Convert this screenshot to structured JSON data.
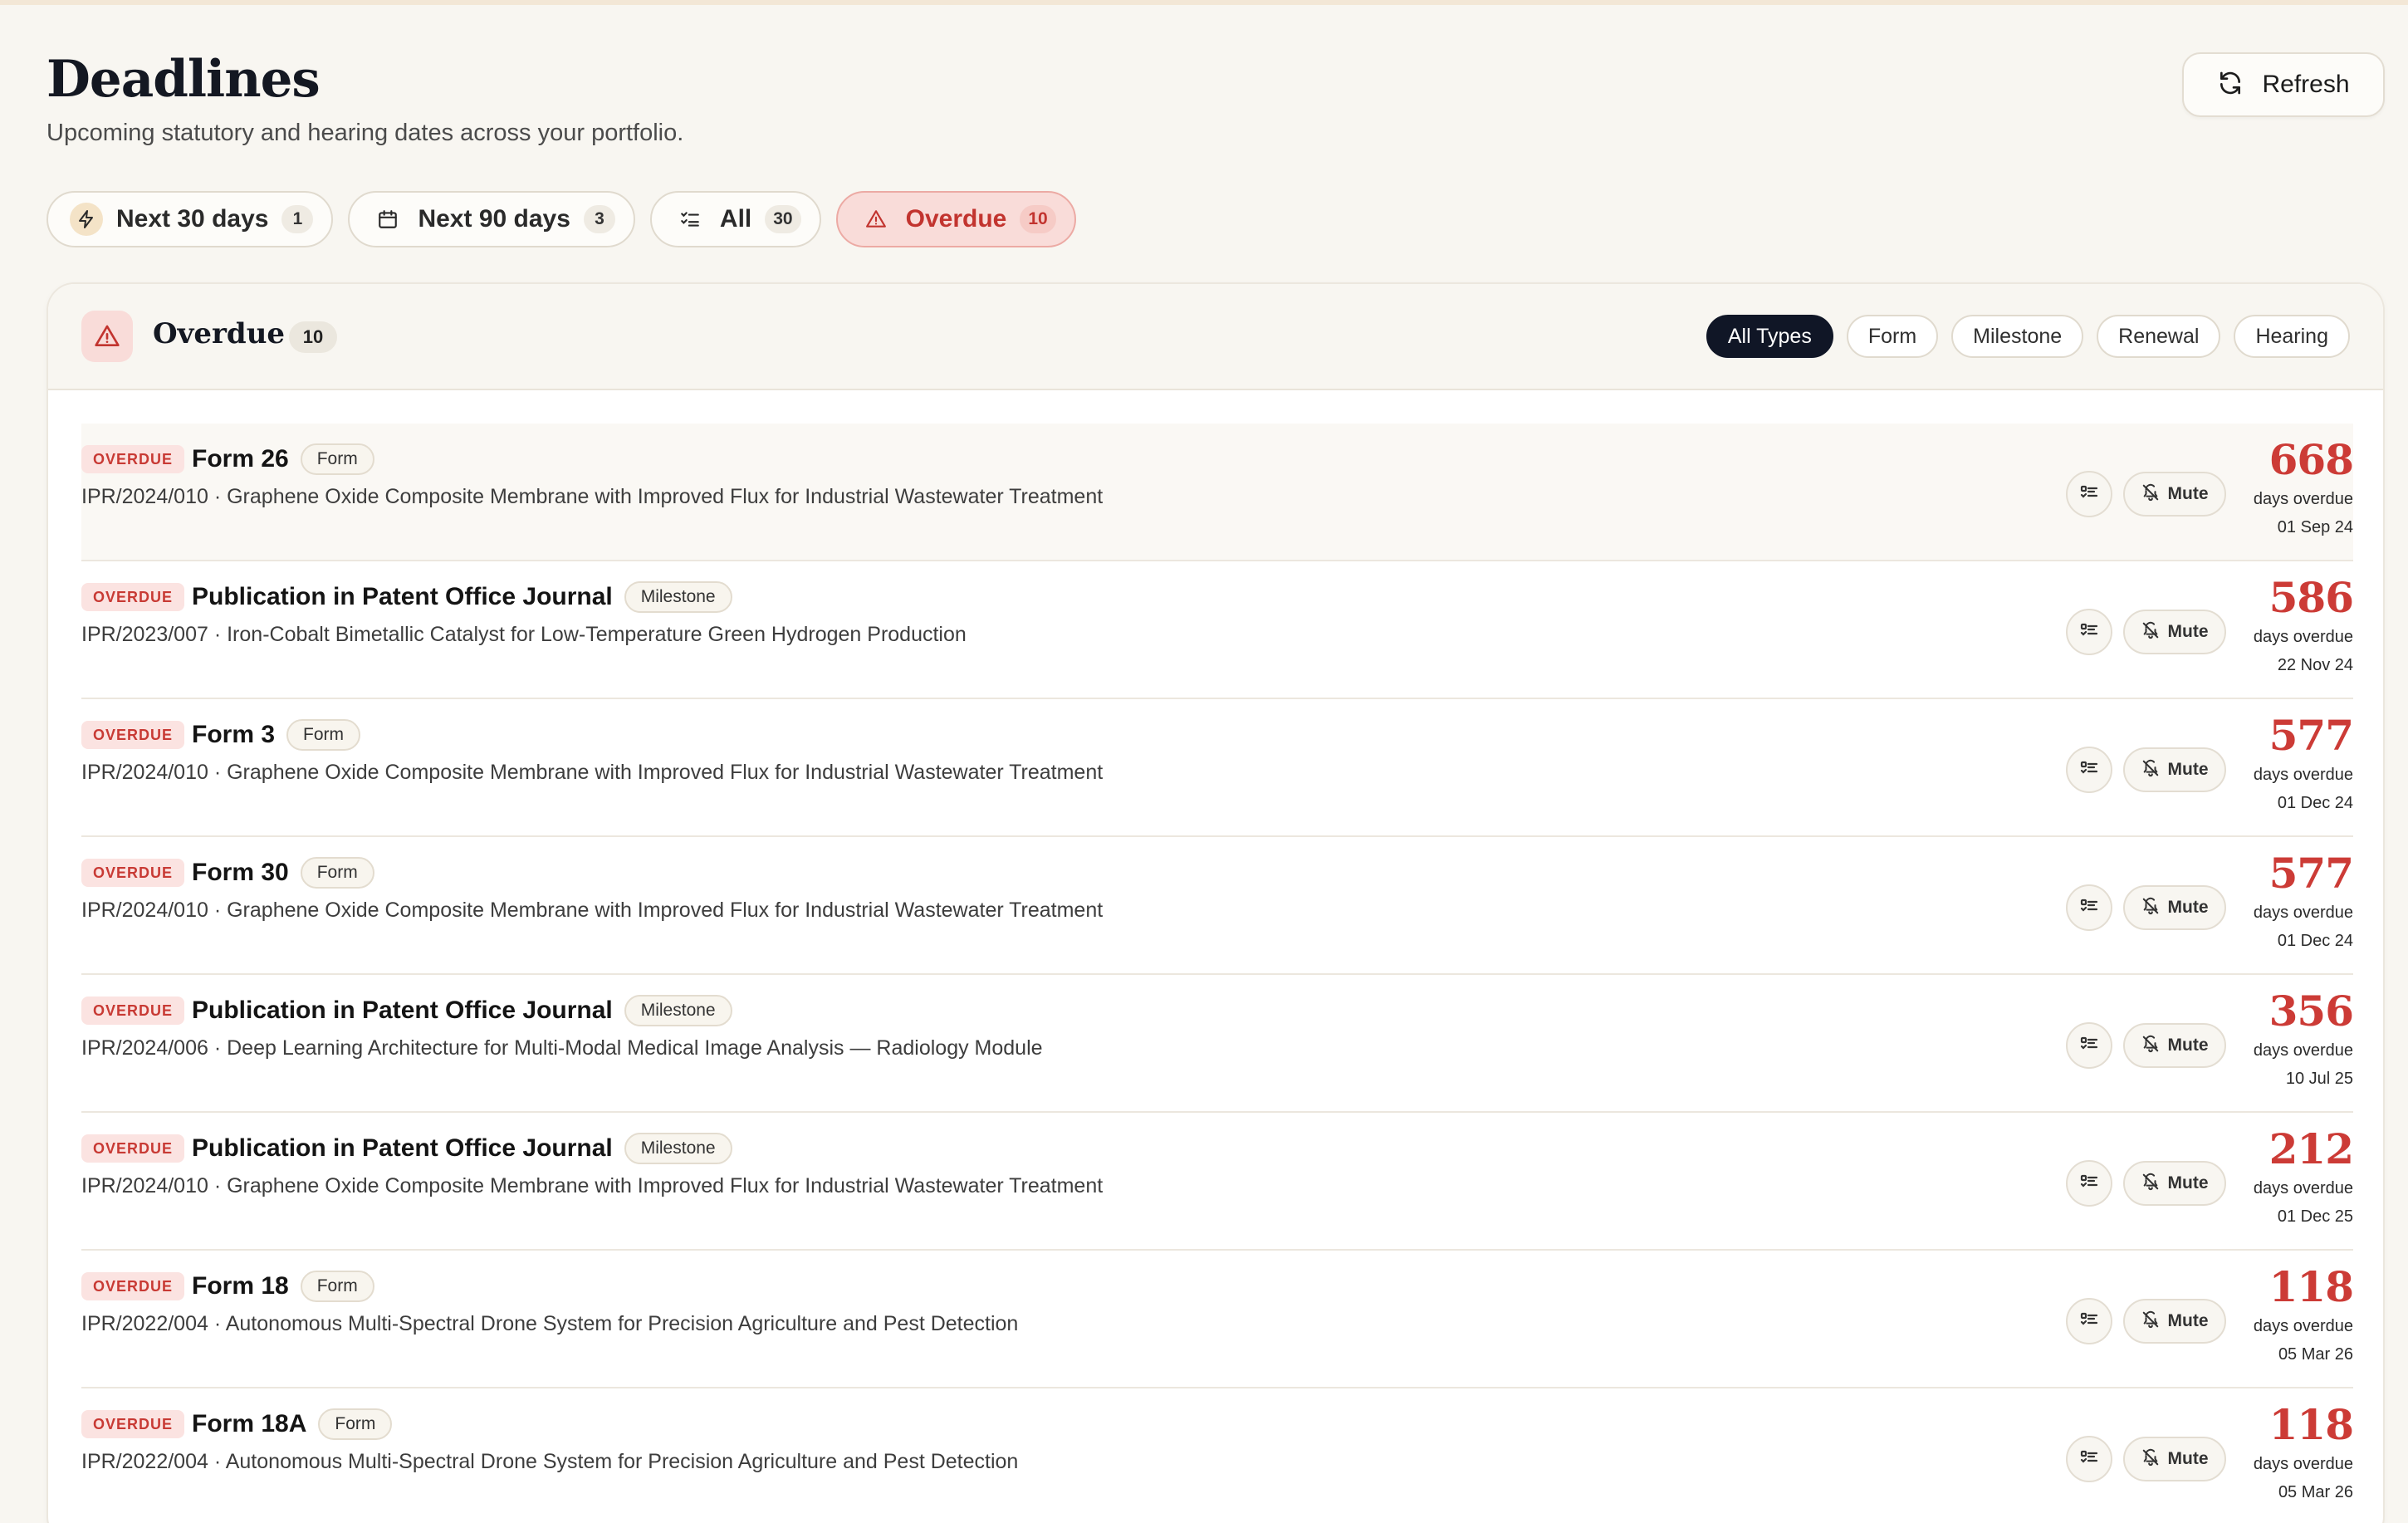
{
  "header": {
    "title": "Deadlines",
    "subtitle": "Upcoming statutory and hearing dates across your portfolio.",
    "refresh_label": "Refresh"
  },
  "tabs": [
    {
      "label": "Next 30 days",
      "count": "1",
      "icon": "bolt-icon"
    },
    {
      "label": "Next 90 days",
      "count": "3",
      "icon": "calendar-icon"
    },
    {
      "label": "All",
      "count": "30",
      "icon": "list-checks-icon"
    },
    {
      "label": "Overdue",
      "count": "10",
      "icon": "warning-triangle-icon",
      "active": true
    }
  ],
  "panel": {
    "title": "Overdue",
    "count": "10",
    "type_filters": [
      "All Types",
      "Form",
      "Milestone",
      "Renewal",
      "Hearing"
    ],
    "active_filter": "All Types"
  },
  "row_labels": {
    "badge": "OVERDUE",
    "mute": "Mute",
    "days_overdue": "days overdue"
  },
  "rows": [
    {
      "title": "Form 26",
      "type": "Form",
      "matter": "IPR/2024/010 · Graphene Oxide Composite Membrane with Improved Flux for Industrial Wastewater Treatment",
      "days": "668",
      "date": "01 Sep 24"
    },
    {
      "title": "Publication in Patent Office Journal",
      "type": "Milestone",
      "matter": "IPR/2023/007 · Iron-Cobalt Bimetallic Catalyst for Low-Temperature Green Hydrogen Production",
      "days": "586",
      "date": "22 Nov 24"
    },
    {
      "title": "Form 3",
      "type": "Form",
      "matter": "IPR/2024/010 · Graphene Oxide Composite Membrane with Improved Flux for Industrial Wastewater Treatment",
      "days": "577",
      "date": "01 Dec 24"
    },
    {
      "title": "Form 30",
      "type": "Form",
      "matter": "IPR/2024/010 · Graphene Oxide Composite Membrane with Improved Flux for Industrial Wastewater Treatment",
      "days": "577",
      "date": "01 Dec 24"
    },
    {
      "title": "Publication in Patent Office Journal",
      "type": "Milestone",
      "matter": "IPR/2024/006 · Deep Learning Architecture for Multi-Modal Medical Image Analysis — Radiology Module",
      "days": "356",
      "date": "10 Jul 25"
    },
    {
      "title": "Publication in Patent Office Journal",
      "type": "Milestone",
      "matter": "IPR/2024/010 · Graphene Oxide Composite Membrane with Improved Flux for Industrial Wastewater Treatment",
      "days": "212",
      "date": "01 Dec 25"
    },
    {
      "title": "Form 18",
      "type": "Form",
      "matter": "IPR/2022/004 · Autonomous Multi-Spectral Drone System for Precision Agriculture and Pest Detection",
      "days": "118",
      "date": "05 Mar 26"
    },
    {
      "title": "Form 18A",
      "type": "Form",
      "matter": "IPR/2022/004 · Autonomous Multi-Spectral Drone System for Precision Agriculture and Pest Detection",
      "days": "118",
      "date": "05 Mar 26"
    }
  ],
  "colors": {
    "background": "#f8f6f1",
    "overdue_red": "#cc3b36",
    "active_filter_bg": "#101626"
  }
}
